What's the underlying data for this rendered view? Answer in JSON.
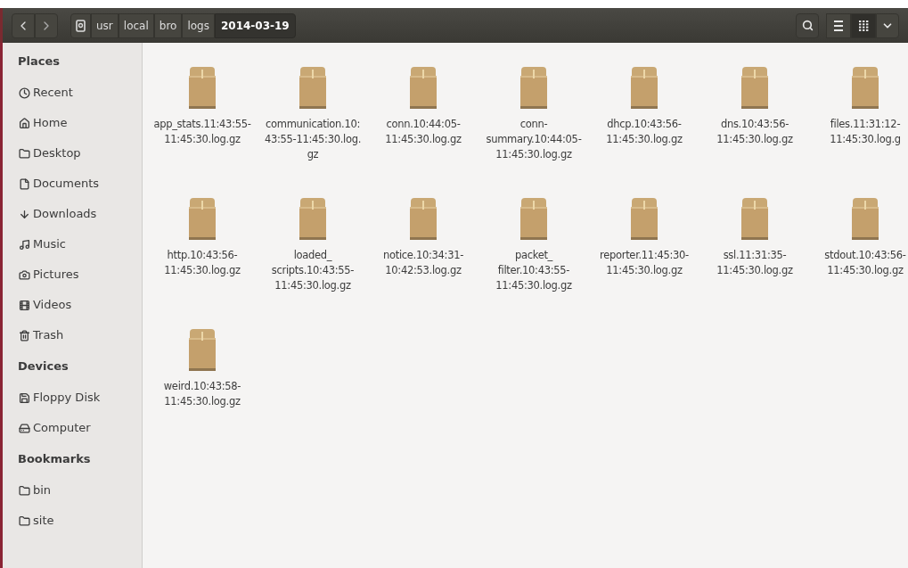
{
  "toolbar": {
    "breadcrumb": [
      {
        "label": "usr",
        "selected": false
      },
      {
        "label": "local",
        "selected": false
      },
      {
        "label": "bro",
        "selected": false
      },
      {
        "label": "logs",
        "selected": false
      },
      {
        "label": "2014-03-19",
        "selected": true
      }
    ],
    "view_buttons": [
      {
        "kind": "list",
        "selected": false
      },
      {
        "kind": "grid",
        "selected": true
      }
    ]
  },
  "sidebar": {
    "sections": [
      {
        "heading": "Places",
        "items": [
          "Recent",
          "Home",
          "Desktop",
          "Documents",
          "Downloads",
          "Music",
          "Pictures",
          "Videos",
          "Trash"
        ]
      },
      {
        "heading": "Devices",
        "items": [
          "Floppy Disk",
          "Computer"
        ]
      },
      {
        "heading": "Bookmarks",
        "items": [
          "bin",
          "site"
        ]
      }
    ]
  },
  "files": [
    {
      "lines": [
        "app_stats.11:43:55-",
        "11:45:30.log.gz"
      ]
    },
    {
      "lines": [
        "communication.10:",
        "43:55-11:45:30.log.",
        "gz"
      ]
    },
    {
      "lines": [
        "conn.10:44:05-",
        "11:45:30.log.gz"
      ]
    },
    {
      "lines": [
        "conn-",
        "summary.10:44:05-",
        "11:45:30.log.gz"
      ]
    },
    {
      "lines": [
        "dhcp.10:43:56-",
        "11:45:30.log.gz"
      ]
    },
    {
      "lines": [
        "dns.10:43:56-",
        "11:45:30.log.gz"
      ]
    },
    {
      "lines": [
        "files.11:31:12-",
        "11:45:30.log.g"
      ]
    },
    {
      "lines": [
        "http.10:43:56-",
        "11:45:30.log.gz"
      ]
    },
    {
      "lines": [
        "loaded_",
        "scripts.10:43:55-",
        "11:45:30.log.gz"
      ]
    },
    {
      "lines": [
        "notice.10:34:31-",
        "10:42:53.log.gz"
      ]
    },
    {
      "lines": [
        "packet_",
        "filter.10:43:55-",
        "11:45:30.log.gz"
      ]
    },
    {
      "lines": [
        "reporter.11:45:30-",
        "11:45:30.log.gz"
      ]
    },
    {
      "lines": [
        "ssl.11:31:35-",
        "11:45:30.log.gz"
      ]
    },
    {
      "lines": [
        "stdout.10:43:56-",
        "11:45:30.log.gz"
      ]
    },
    {
      "lines": [
        "weird.10:43:58-",
        "11:45:30.log.gz"
      ]
    }
  ]
}
